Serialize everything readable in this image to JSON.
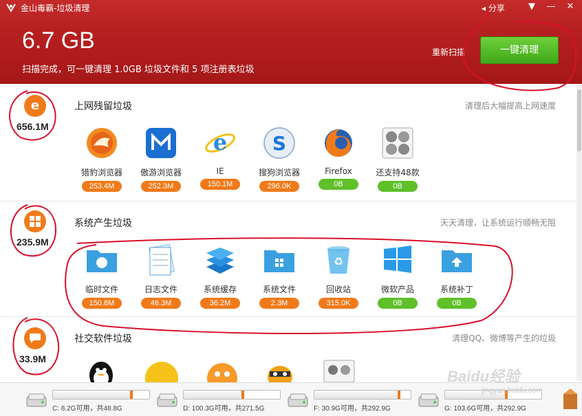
{
  "window": {
    "title": "金山毒霸-垃圾清理",
    "share_label": "分享"
  },
  "summary": {
    "total_size": "6.7 GB",
    "scan_text": "扫描完成，可一键清理 1.0GB 垃圾文件和 5 项注册表垃圾",
    "rescan_label": "重新扫描",
    "clean_label": "一键清理"
  },
  "sections": [
    {
      "size": "656.1M",
      "title": "上网残留垃圾",
      "tip": "清理后大幅提高上网速度",
      "items": [
        {
          "label": "猎豹浏览器",
          "size": "253.4M",
          "status": "orange",
          "icon": "cheetah-browser-icon"
        },
        {
          "label": "傲游浏览器",
          "size": "252.3M",
          "status": "orange",
          "icon": "maxthon-browser-icon"
        },
        {
          "label": "IE",
          "size": "150.1M",
          "status": "orange",
          "icon": "ie-browser-icon"
        },
        {
          "label": "搜狗浏览器",
          "size": "296.0K",
          "status": "orange",
          "icon": "sogou-browser-icon"
        },
        {
          "label": "Firefox",
          "size": "0B",
          "status": "green",
          "icon": "firefox-icon"
        },
        {
          "label": "还支持48款",
          "size": "0B",
          "status": "green",
          "icon": "more-browsers-icon"
        }
      ]
    },
    {
      "size": "235.9M",
      "title": "系统产生垃圾",
      "tip": "天天清理，让系统运行顺畅无阻",
      "items": [
        {
          "label": "临时文件",
          "size": "150.8M",
          "status": "orange",
          "icon": "temp-folder-icon"
        },
        {
          "label": "日志文件",
          "size": "46.3M",
          "status": "orange",
          "icon": "log-file-icon"
        },
        {
          "label": "系统缓存",
          "size": "36.2M",
          "status": "orange",
          "icon": "system-cache-icon"
        },
        {
          "label": "系统文件",
          "size": "2.3M",
          "status": "orange",
          "icon": "system-folder-icon"
        },
        {
          "label": "回收站",
          "size": "315.0K",
          "status": "orange",
          "icon": "recycle-bin-icon"
        },
        {
          "label": "微软产品",
          "size": "0B",
          "status": "green",
          "icon": "windows-logo-icon"
        },
        {
          "label": "系统补丁",
          "size": "0B",
          "status": "green",
          "icon": "patch-folder-icon"
        }
      ]
    },
    {
      "size": "33.9M",
      "title": "社交软件垃圾",
      "tip": "清理QQ、微博等产生的垃圾"
    }
  ],
  "drives": [
    {
      "text": "C: 8.2G可用，共48.8G",
      "used_fraction": 0.83
    },
    {
      "text": "D: 100.3G可用，共271.5G",
      "used_fraction": 0.63
    },
    {
      "text": "F: 30.9G可用，共292.9G",
      "used_fraction": 0.89
    },
    {
      "text": "G: 103.6G可用，共292.9G",
      "used_fraction": 0.65
    }
  ],
  "watermark": {
    "brand": "Baidu经验",
    "url": "jingyan.baidu.com"
  },
  "colors": {
    "header_red": "#b51e1e",
    "clean_green": "#4fb826",
    "badge_orange": "#f07a1a",
    "badge_green": "#5fc02a"
  }
}
